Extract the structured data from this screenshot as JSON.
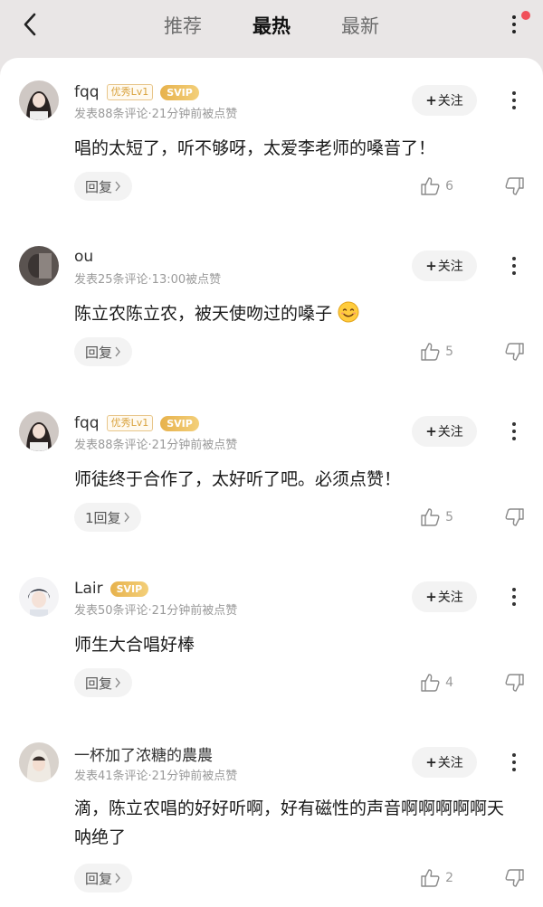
{
  "header": {
    "tabs": [
      {
        "label": "推荐",
        "active": false
      },
      {
        "label": "最热",
        "active": true
      },
      {
        "label": "最新",
        "active": false
      }
    ],
    "notification_dot_color": "#f0505a"
  },
  "follow_label": "关注",
  "comments": [
    {
      "username": "fqq",
      "level_badge": "优秀Lv1",
      "vip_badge": "SVIP",
      "meta": "发表88条评论·21分钟前被点赞",
      "text": "唱的太短了，听不够呀，太爱李老师的嗓音了！",
      "reply_label": "回复",
      "likes": "6",
      "avatar_icon": "girl-portrait-avatar"
    },
    {
      "username": "ou",
      "level_badge": "",
      "vip_badge": "",
      "meta": "发表25条评论·13:00被点赞",
      "text": "陈立农陈立农，被天使吻过的嗓子",
      "emoji": "smiling-face-emoji",
      "reply_label": "回复",
      "likes": "5",
      "avatar_icon": "dark-photo-avatar"
    },
    {
      "username": "fqq",
      "level_badge": "优秀Lv1",
      "vip_badge": "SVIP",
      "meta": "发表88条评论·21分钟前被点赞",
      "text": "师徒终于合作了，太好听了吧。必须点赞！",
      "reply_label": "1回复",
      "likes": "5",
      "avatar_icon": "girl-portrait-avatar"
    },
    {
      "username": "Lair",
      "level_badge": "",
      "vip_badge": "SVIP",
      "meta": "发表50条评论·21分钟前被点赞",
      "text": "师生大合唱好棒",
      "reply_label": "回复",
      "likes": "4",
      "avatar_icon": "boy-portrait-avatar"
    },
    {
      "username": "一杯加了浓糖的農農",
      "level_badge": "",
      "vip_badge": "",
      "meta": "发表41条评论·21分钟前被点赞",
      "text": "滴，陈立农唱的好好听啊，好有磁性的声音啊啊啊啊啊天呐绝了",
      "reply_label": "回复",
      "likes": "2",
      "avatar_icon": "light-portrait-avatar"
    }
  ]
}
